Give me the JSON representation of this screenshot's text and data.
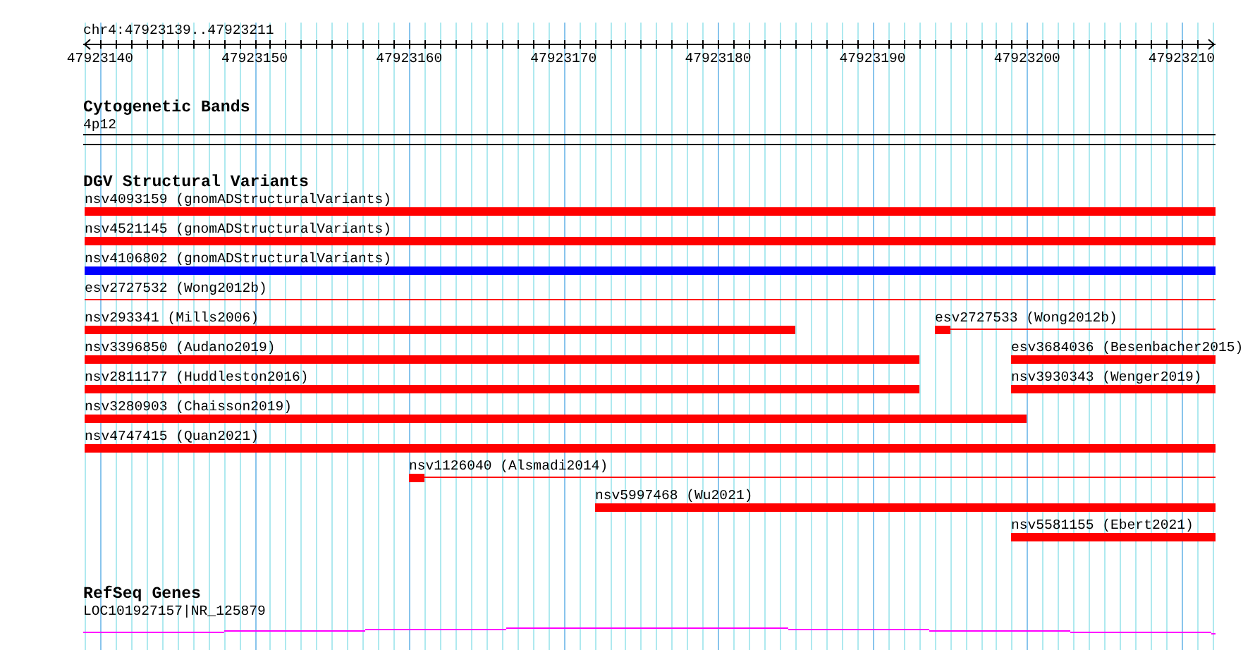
{
  "ruler": {
    "location": "chr4:47923139..47923211",
    "ticks": [
      "47923140",
      "47923150",
      "47923160",
      "47923170",
      "47923180",
      "47923190",
      "47923200",
      "47923210"
    ]
  },
  "tracks": [
    {
      "kind": "bands",
      "title": "Cytogenetic Bands",
      "features": [
        {
          "label": "4p12"
        }
      ]
    },
    {
      "kind": "variants",
      "title": "DGV Structural Variants",
      "features": [
        {
          "label": "nsv4093159 (gnomADStructuralVariants)",
          "kind": "bar",
          "color": "#ff0000"
        },
        {
          "label": "nsv4521145 (gnomADStructuralVariants)",
          "kind": "bar",
          "color": "#ff0000"
        },
        {
          "label": "nsv4106802 (gnomADStructuralVariants)",
          "kind": "bar",
          "color": "#0000ff"
        },
        {
          "label": "esv2727532 (Wong2012b)",
          "kind": "line",
          "color": "#ff0000"
        },
        {
          "label": "nsv293341 (Mills2006)",
          "kind": "bar",
          "color": "#ff0000"
        },
        {
          "label": "esv2727533 (Wong2012b)",
          "kind": "head",
          "color": "#ff0000"
        },
        {
          "label": "nsv3396850 (Audano2019)",
          "kind": "bar",
          "color": "#ff0000"
        },
        {
          "label": "esv3684036 (Besenbacher2015)",
          "kind": "bar",
          "color": "#ff0000"
        },
        {
          "label": "nsv2811177 (Huddleston2016)",
          "kind": "bar",
          "color": "#ff0000"
        },
        {
          "label": "nsv3930343 (Wenger2019)",
          "kind": "bar",
          "color": "#ff0000"
        },
        {
          "label": "nsv3280903 (Chaisson2019)",
          "kind": "bar",
          "color": "#ff0000"
        },
        {
          "label": "nsv4747415 (Quan2021)",
          "kind": "bar",
          "color": "#ff0000"
        },
        {
          "label": "nsv1126040 (Alsmadi2014)",
          "kind": "head",
          "color": "#ff0000"
        },
        {
          "label": "nsv5997468 (Wu2021)",
          "kind": "bar",
          "color": "#ff0000"
        },
        {
          "label": "nsv5581155 (Ebert2021)",
          "kind": "bar",
          "color": "#ff0000"
        }
      ]
    },
    {
      "kind": "genes",
      "title": "RefSeq Genes",
      "features": [
        {
          "label": "LOC101927157|NR_125879",
          "color": "#ff00ff"
        }
      ]
    }
  ]
}
